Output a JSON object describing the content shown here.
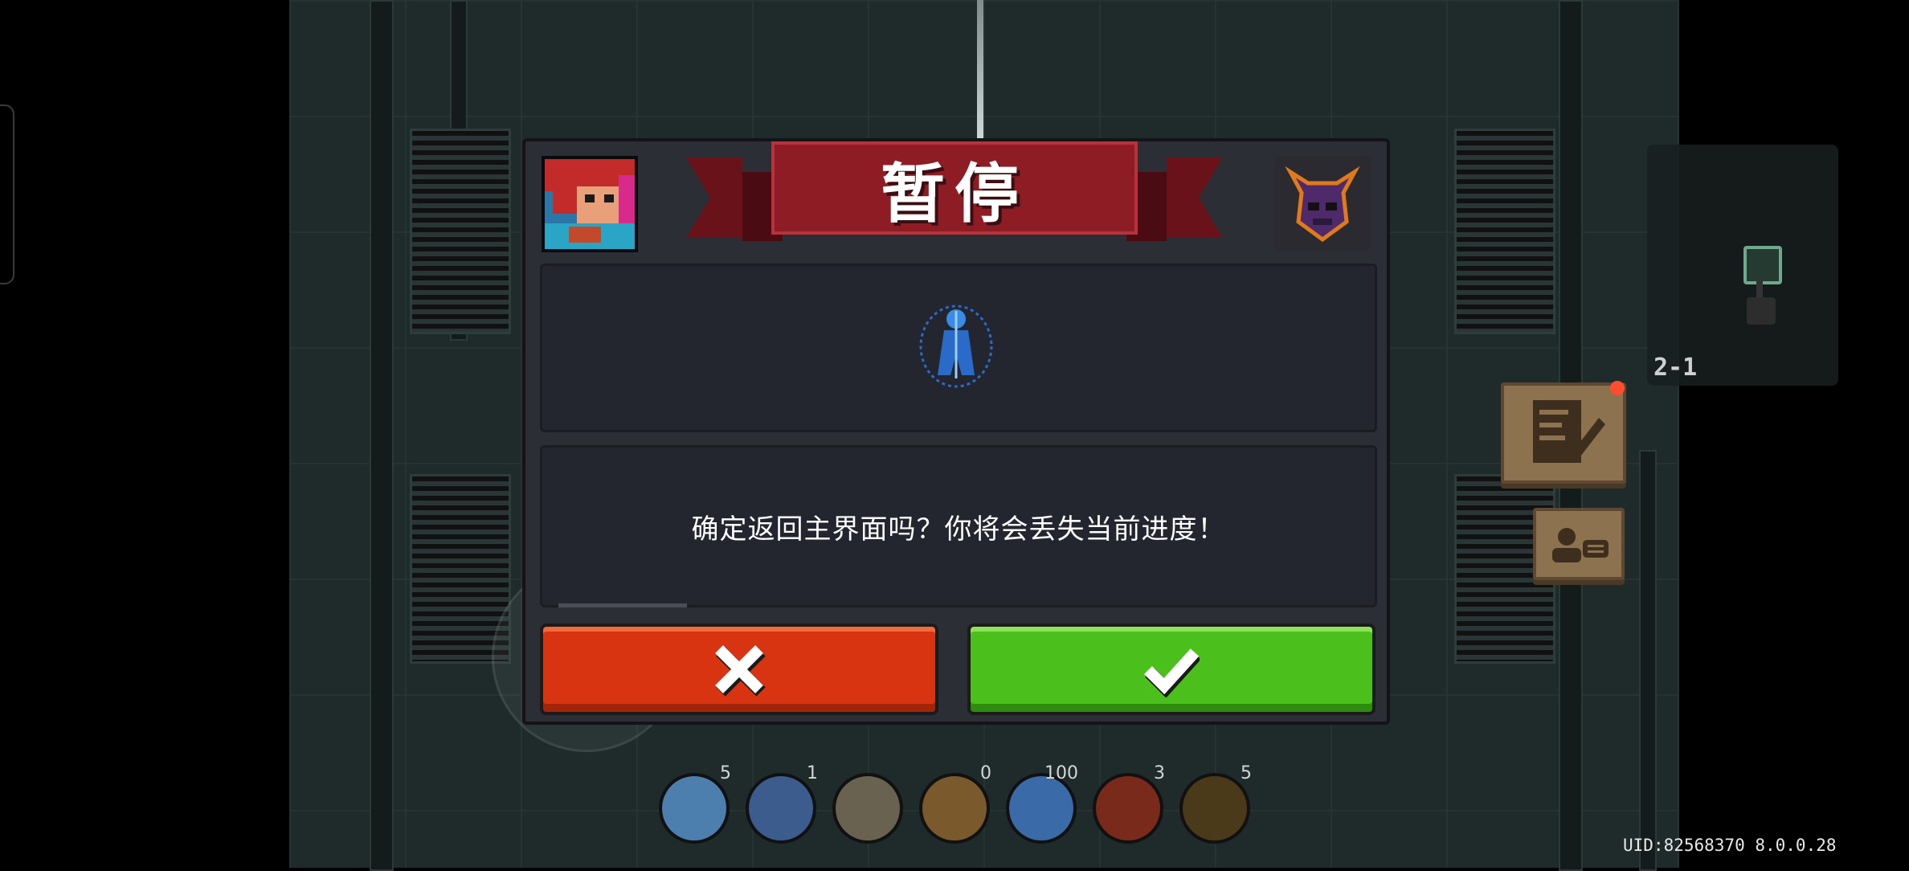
{
  "dialog": {
    "title": "暂停",
    "message": "确定返回主界面吗？你将会丢失当前进度！",
    "character_icon": "knight-portrait-icon",
    "boss_icon": "horned-demon-helmet-icon",
    "buff_icon": "blue-spirit-figure-icon",
    "cancel_icon": "x-icon",
    "confirm_icon": "checkmark-icon"
  },
  "minimap": {
    "level": "2-1"
  },
  "side_buttons": {
    "notes_icon": "notes-pencil-icon",
    "profile_icon": "profile-card-icon"
  },
  "items": [
    {
      "icon": "ghost-blade-icon",
      "count": "5",
      "color": "#4c7fae"
    },
    {
      "icon": "shield-door-icon",
      "count": "1",
      "color": "#3b5c8c"
    },
    {
      "icon": "pillar-icon",
      "count": "",
      "color": "#6a6250"
    },
    {
      "icon": "fist-icon",
      "count": "0",
      "color": "#7a5a2c"
    },
    {
      "icon": "red-character-icon",
      "count": "100",
      "color": "#3a6aa8"
    },
    {
      "icon": "fire-icon",
      "count": "3",
      "color": "#7a2a1a"
    },
    {
      "icon": "music-note-icon",
      "count": "5",
      "color": "#4a3a1a"
    }
  ],
  "footer": {
    "uid": "UID:82568370 8.0.0.28"
  },
  "colors": {
    "cancel": "#d93412",
    "confirm": "#4bbf1c",
    "banner": "#8e1c24",
    "panel": "#23262e"
  }
}
